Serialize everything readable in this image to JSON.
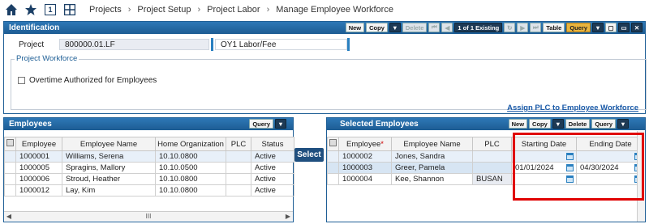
{
  "nav": {
    "crumbs": [
      "Projects",
      "Project Setup",
      "Project Labor",
      "Manage Employee Workforce"
    ],
    "badge": "1"
  },
  "identification": {
    "title": "Identification",
    "toolbar": [
      "New",
      "Copy",
      "Delete",
      "1 of 1 Existing",
      "Table",
      "Query"
    ],
    "project_label": "Project",
    "project_value": "800000.01.LF",
    "project_name": "OY1 Labor/Fee"
  },
  "workforce": {
    "title": "Project Workforce",
    "overtime_label": "Overtime Authorized for Employees"
  },
  "assign_link": "Assign PLC to Employee Workforce",
  "employees": {
    "title": "Employees",
    "query": "Query",
    "columns": [
      "Employee",
      "Employee Name",
      "Home Organization",
      "PLC",
      "Status"
    ],
    "rows": [
      [
        "1000001",
        "Williams, Serena",
        "10.10.0800",
        "",
        "Active"
      ],
      [
        "1000005",
        "Spragins, Mallory",
        "10.10.0500",
        "",
        "Active"
      ],
      [
        "1000006",
        "Stroud, Heather",
        "10.10.0800",
        "",
        "Active"
      ],
      [
        "1000012",
        "Lay, Kim",
        "10.10.0800",
        "",
        "Active"
      ]
    ],
    "scroll_mark": "III"
  },
  "select_label": "Select",
  "selected": {
    "title": "Selected Employees",
    "toolbar": [
      "New",
      "Copy",
      "Delete",
      "Query"
    ],
    "columns": [
      "Employee",
      "Employee Name",
      "PLC",
      "Starting Date",
      "Ending Date"
    ],
    "required_mark": "*",
    "rows": [
      [
        "1000002",
        "Jones, Sandra",
        "",
        "",
        ""
      ],
      [
        "1000003",
        "Greer, Pamela",
        "",
        "01/01/2024",
        "04/30/2024"
      ],
      [
        "1000004",
        "Kee, Shannon",
        "BUSAN",
        "",
        ""
      ]
    ]
  }
}
